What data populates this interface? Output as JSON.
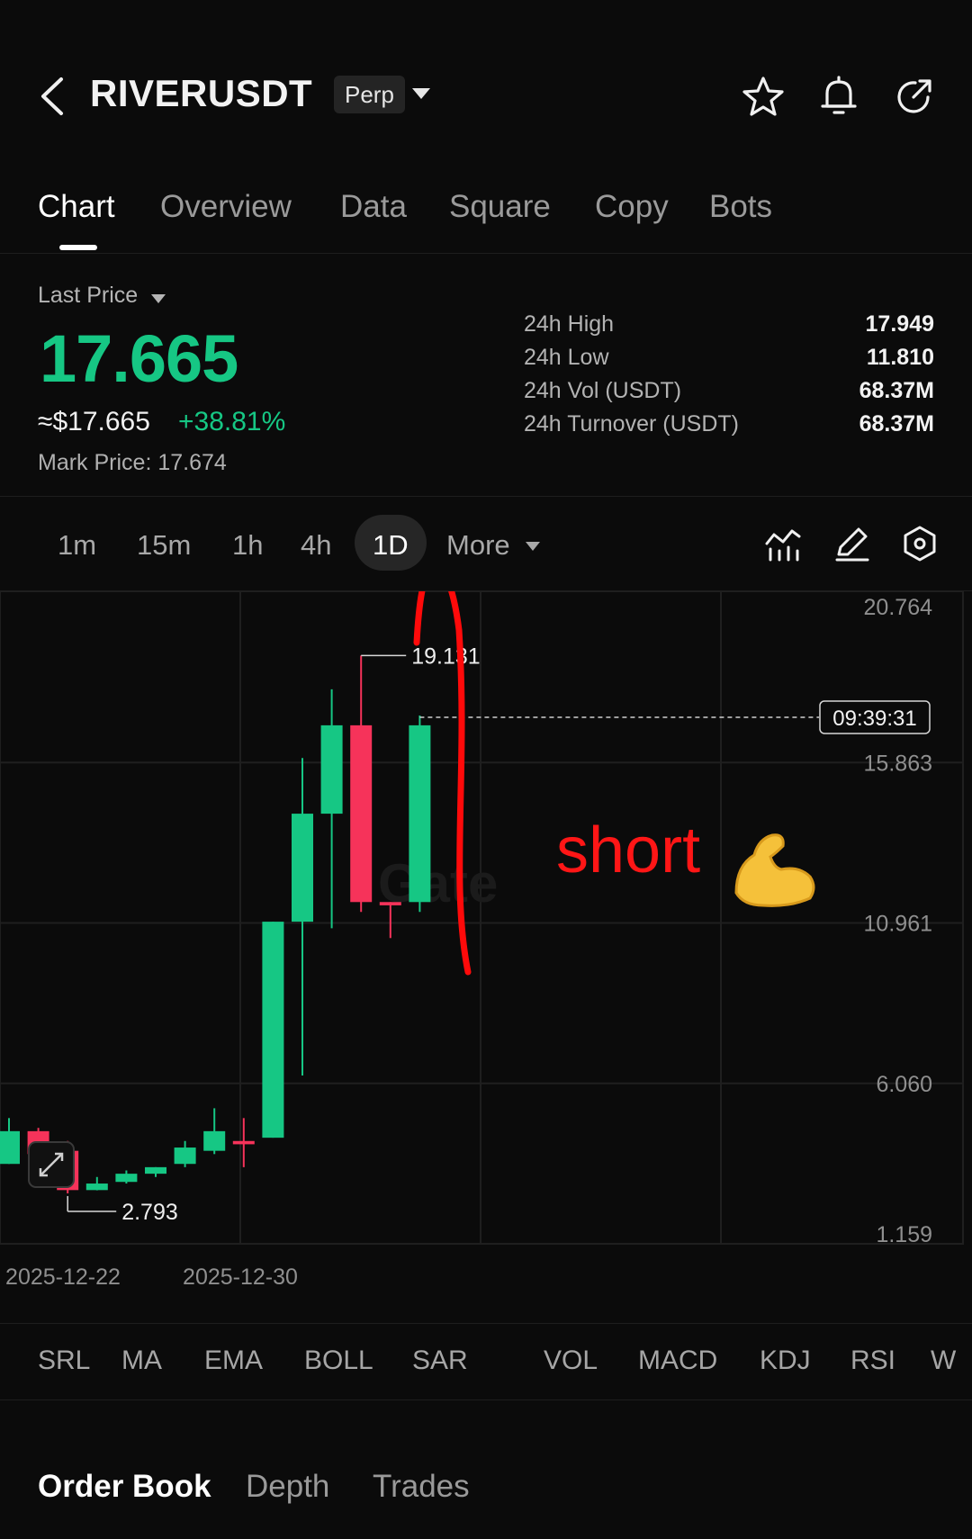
{
  "header": {
    "symbol": "RIVERUSDT",
    "badge": "Perp",
    "icons": [
      "back-icon",
      "star-icon",
      "bell-icon",
      "share-icon"
    ]
  },
  "tabs": [
    "Chart",
    "Overview",
    "Data",
    "Square",
    "Copy",
    "Bots"
  ],
  "price": {
    "last_price_label": "Last Price",
    "value": "17.665",
    "usd": "≈$17.665",
    "change": "+38.81%",
    "mark": "Mark Price: 17.674"
  },
  "stats": [
    {
      "label": "24h  High",
      "value": "17.949"
    },
    {
      "label": "24h  Low",
      "value": "11.810"
    },
    {
      "label": "24h  Vol (USDT)",
      "value": "68.37M"
    },
    {
      "label": "24h  Turnover (USDT)",
      "value": "68.37M"
    }
  ],
  "intervals": [
    "1m",
    "15m",
    "1h",
    "4h",
    "1D",
    "More"
  ],
  "chart_data": {
    "type": "candlestick",
    "y_ticks": [
      "20.764",
      "15.863",
      "10.961",
      "6.060",
      "1.159"
    ],
    "x_ticks": [
      "2025-12-22",
      "2025-12-30"
    ],
    "ylim": [
      1.159,
      20.764
    ],
    "high_label": "19.131",
    "low_label": "2.793",
    "countdown": "09:39:31",
    "watermark": "Gate",
    "annotation": "short",
    "candles": [
      {
        "open": 3.6,
        "high": 5.0,
        "low": 3.6,
        "close": 4.6
      },
      {
        "open": 4.6,
        "high": 4.7,
        "low": 4.0,
        "close": 3.9
      },
      {
        "open": 4.0,
        "high": 4.3,
        "low": 2.7,
        "close": 2.8
      },
      {
        "open": 2.8,
        "high": 3.2,
        "low": 2.793,
        "close": 3.0
      },
      {
        "open": 3.05,
        "high": 3.4,
        "low": 3.0,
        "close": 3.3
      },
      {
        "open": 3.3,
        "high": 3.5,
        "low": 3.2,
        "close": 3.5
      },
      {
        "open": 3.6,
        "high": 4.3,
        "low": 3.5,
        "close": 4.1
      },
      {
        "open": 4.0,
        "high": 5.3,
        "low": 3.9,
        "close": 4.6
      },
      {
        "open": 4.3,
        "high": 5.0,
        "low": 3.5,
        "close": 4.2
      },
      {
        "open": 4.4,
        "high": 11.0,
        "low": 4.4,
        "close": 11.0
      },
      {
        "open": 11.0,
        "high": 16.0,
        "low": 6.3,
        "close": 14.3
      },
      {
        "open": 14.3,
        "high": 18.1,
        "low": 10.8,
        "close": 17.0
      },
      {
        "open": 17.0,
        "high": 19.131,
        "low": 11.3,
        "close": 11.6
      },
      {
        "open": 11.6,
        "high": 11.6,
        "low": 10.5,
        "close": 11.5
      },
      {
        "open": 11.6,
        "high": 17.3,
        "low": 11.3,
        "close": 17.0
      }
    ]
  },
  "indicators": [
    "SRL",
    "MA",
    "EMA",
    "BOLL",
    "SAR",
    "VOL",
    "MACD",
    "KDJ",
    "RSI",
    "W"
  ],
  "bottom_tabs": [
    "Order Book",
    "Depth",
    "Trades"
  ]
}
